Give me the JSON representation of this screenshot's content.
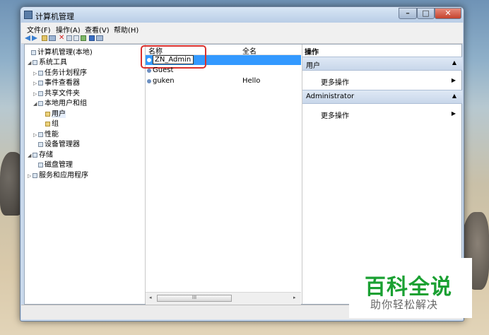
{
  "window": {
    "title": "计算机管理",
    "min_glyph": "–",
    "max_glyph": "□",
    "close_glyph": "✕"
  },
  "menu": [
    "文件(F)",
    "操作(A)",
    "查看(V)",
    "帮助(H)"
  ],
  "tree": [
    {
      "label": "计算机管理(本地)",
      "expander": "",
      "icon": "computer-management-icon"
    },
    {
      "label": "系统工具",
      "expander": "◢",
      "icon": "system-tools-icon"
    },
    {
      "label": "任务计划程序",
      "expander": "▷",
      "icon": "task-scheduler-icon"
    },
    {
      "label": "事件查看器",
      "expander": "▷",
      "icon": "event-viewer-icon"
    },
    {
      "label": "共享文件夹",
      "expander": "▷",
      "icon": "shared-folders-icon"
    },
    {
      "label": "本地用户和组",
      "expander": "◢",
      "icon": "local-users-groups-icon"
    },
    {
      "label": "用户",
      "expander": "",
      "icon": "users-folder-icon"
    },
    {
      "label": "组",
      "expander": "",
      "icon": "groups-folder-icon"
    },
    {
      "label": "性能",
      "expander": "▷",
      "icon": "performance-icon"
    },
    {
      "label": "设备管理器",
      "expander": "",
      "icon": "device-manager-icon"
    },
    {
      "label": "存储",
      "expander": "◢",
      "icon": "storage-icon"
    },
    {
      "label": "磁盘管理",
      "expander": "",
      "icon": "disk-management-icon"
    },
    {
      "label": "服务和应用程序",
      "expander": "▷",
      "icon": "services-applications-icon"
    }
  ],
  "list": {
    "col_name": "名称",
    "col_fullname": "全名",
    "edit_value": "ZN_Admin",
    "rows": [
      {
        "name": "Guest",
        "fullname": ""
      },
      {
        "name": "guken",
        "fullname": "Hello"
      }
    ],
    "scroll_left": "◂",
    "scroll_right": "▸",
    "scroll_grip": "III"
  },
  "actions": {
    "title": "操作",
    "sections": [
      {
        "label": "用户",
        "item": "更多操作"
      },
      {
        "label": "Administrator",
        "item": "更多操作"
      }
    ],
    "collapse_glyph": "▲",
    "arrow_glyph": "▶"
  },
  "watermark": {
    "main": "百科全说",
    "sub": "助你轻松解决"
  },
  "colors": {
    "selection": "#3399ff",
    "highlight_box": "#d9302c",
    "watermark_green": "#1aa032"
  }
}
